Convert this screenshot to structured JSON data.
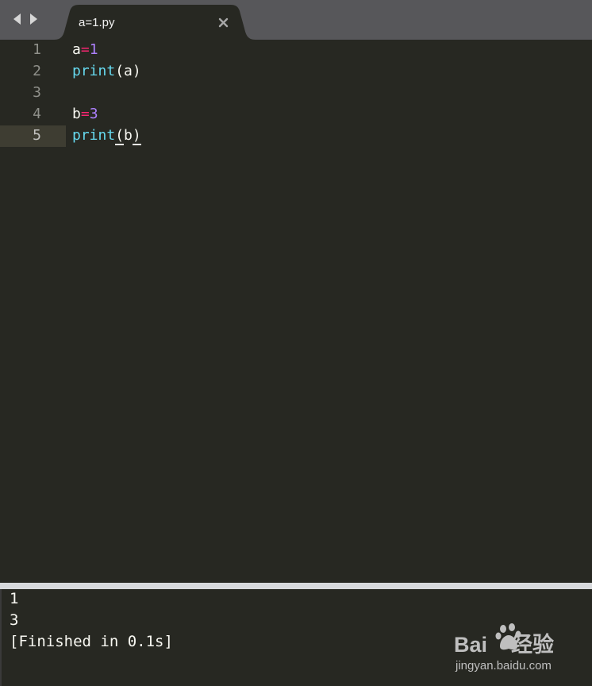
{
  "tab": {
    "title": "a=1.py",
    "close_glyph": "×"
  },
  "editor": {
    "current_line": 5,
    "lines": [
      {
        "number": "1",
        "tokens": [
          {
            "t": "a",
            "k": "plain"
          },
          {
            "t": "=",
            "k": "op"
          },
          {
            "t": "1",
            "k": "num"
          }
        ]
      },
      {
        "number": "2",
        "tokens": [
          {
            "t": "print",
            "k": "fn"
          },
          {
            "t": "(a)",
            "k": "plain"
          }
        ]
      },
      {
        "number": "3",
        "tokens": []
      },
      {
        "number": "4",
        "tokens": [
          {
            "t": "b",
            "k": "plain"
          },
          {
            "t": "=",
            "k": "op"
          },
          {
            "t": "3",
            "k": "num"
          }
        ]
      },
      {
        "number": "5",
        "tokens": [
          {
            "t": "print",
            "k": "fn"
          },
          {
            "t": "(",
            "k": "plain",
            "match": true
          },
          {
            "t": "b",
            "k": "plain"
          },
          {
            "t": ")",
            "k": "plain",
            "match": true
          }
        ]
      }
    ]
  },
  "output": {
    "lines": [
      "1",
      "3",
      "[Finished in 0.1s]"
    ]
  },
  "watermark": {
    "brand": "Baidu 经验",
    "site": "jingyan.baidu.com"
  },
  "colors": {
    "background": "#272822",
    "tabbar": "#57575a",
    "function": "#66d9ef",
    "operator": "#f92672",
    "number": "#ae81ff",
    "text": "#f8f8f2"
  },
  "icons": {
    "nav_back": "chevron-left-icon",
    "nav_forward": "chevron-right-icon",
    "close": "close-icon"
  }
}
